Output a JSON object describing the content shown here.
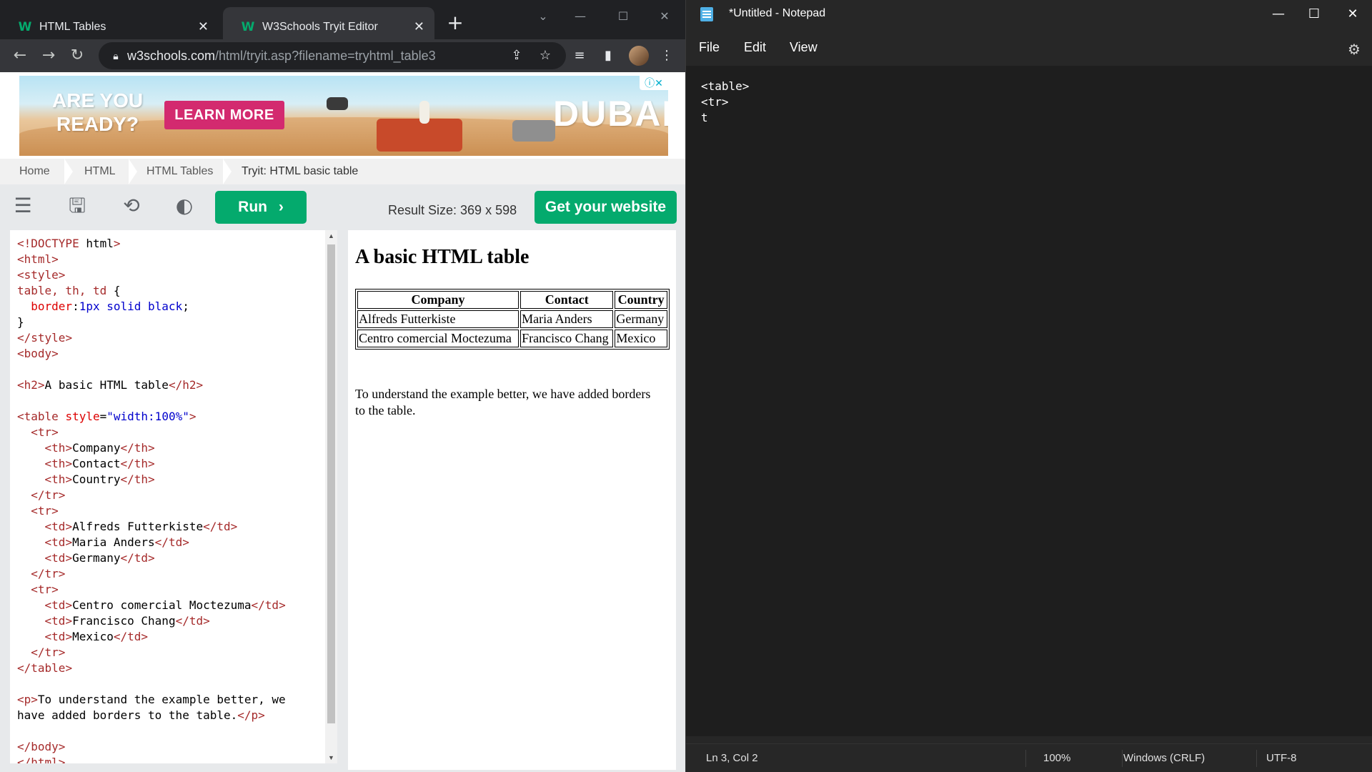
{
  "browser": {
    "tabs": [
      {
        "label": "HTML Tables",
        "favicon": "W"
      },
      {
        "label": "W3Schools Tryit Editor",
        "favicon": "W"
      }
    ],
    "url_host": "w3schools.com",
    "url_path": "/html/tryit.asp?filename=tryhtml_table3"
  },
  "ad": {
    "headline_line1": "ARE YOU",
    "headline_line2": "READY?",
    "cta": "LEARN MORE",
    "logo": "DUBAI"
  },
  "breadcrumb": [
    "Home",
    "HTML",
    "HTML Tables",
    "Tryit: HTML basic table"
  ],
  "tryit": {
    "run_label": "Run",
    "result_size": "Result Size: 369 x 598",
    "get_website": "Get your website"
  },
  "editor": {
    "code_lines": [
      "<!DOCTYPE html>",
      "<html>",
      "<style>",
      "table, th, td {",
      "  border:1px solid black;",
      "}",
      "</style>",
      "<body>",
      "",
      "<h2>A basic HTML table</h2>",
      "",
      "<table style=\"width:100%\">",
      "  <tr>",
      "    <th>Company</th>",
      "    <th>Contact</th>",
      "    <th>Country</th>",
      "  </tr>",
      "  <tr>",
      "    <td>Alfreds Futterkiste</td>",
      "    <td>Maria Anders</td>",
      "    <td>Germany</td>",
      "  </tr>",
      "  <tr>",
      "    <td>Centro comercial Moctezuma</td>",
      "    <td>Francisco Chang</td>",
      "    <td>Mexico</td>",
      "  </tr>",
      "</table>",
      "",
      "<p>To understand the example better, we",
      "have added borders to the table.</p>",
      "",
      "</body>",
      "</html>"
    ]
  },
  "result": {
    "heading": "A basic HTML table",
    "table": {
      "headers": [
        "Company",
        "Contact",
        "Country"
      ],
      "rows": [
        [
          "Alfreds Futterkiste",
          "Maria Anders",
          "Germany"
        ],
        [
          "Centro comercial Moctezuma",
          "Francisco Chang",
          "Mexico"
        ]
      ]
    },
    "paragraph": "To understand the example better, we have added borders to the table."
  },
  "notepad": {
    "title": "*Untitled - Notepad",
    "menus": [
      "File",
      "Edit",
      "View"
    ],
    "text": "<table>\n<tr>\nt",
    "status": {
      "position": "Ln 3, Col 2",
      "zoom": "100%",
      "line_ending": "Windows (CRLF)",
      "encoding": "UTF-8"
    }
  },
  "colors": {
    "w3_green": "#04aa6d",
    "chrome_dark": "#202124",
    "notepad_bg": "#1e1e1e"
  }
}
